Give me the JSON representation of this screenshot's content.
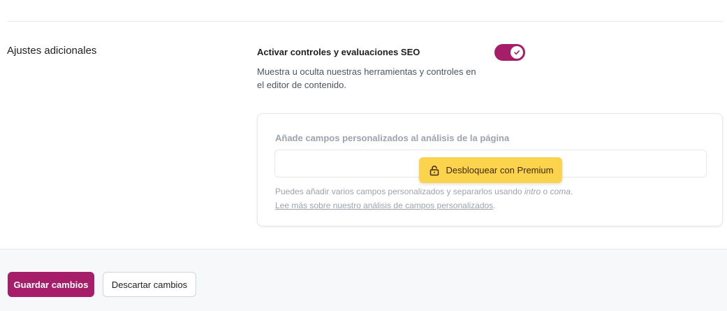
{
  "section": {
    "title": "Ajustes adicionales"
  },
  "seo_setting": {
    "label": "Activar controles y evaluaciones SEO",
    "description": "Muestra u oculta nuestras herramientas y controles en el editor de contenido.",
    "enabled": true
  },
  "premium_card": {
    "label": "Añade campos personalizados al análisis de la página",
    "input_value": "",
    "unlock_label": "Desbloquear con Premium",
    "help_prefix": "Puedes añadir varios campos personalizados y separarlos usando ",
    "help_key1": "intro",
    "help_middle": " o ",
    "help_key2": "coma",
    "help_suffix": ".",
    "link_text": "Lee más sobre nuestro análisis de campos personalizados",
    "link_suffix": "."
  },
  "footer": {
    "save_label": "Guardar cambios",
    "discard_label": "Descartar cambios"
  },
  "colors": {
    "brand": "#a61e69",
    "premium": "#fcd34d"
  },
  "icons": {
    "toggle": "check-icon",
    "unlock": "unlock-icon"
  }
}
